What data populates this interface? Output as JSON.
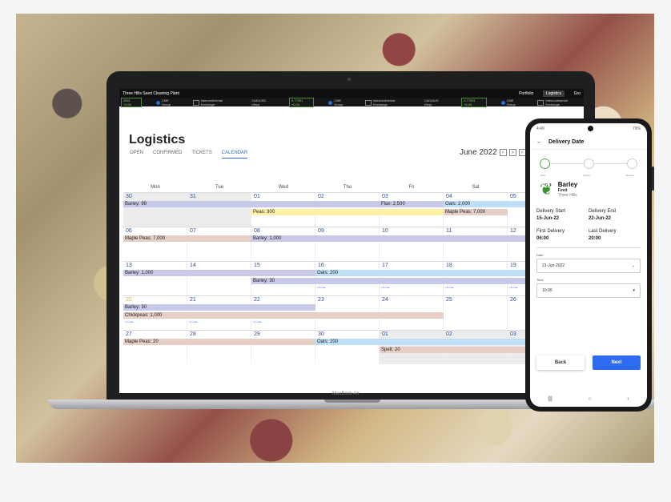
{
  "app": {
    "title": "Three Hills Seed Cleaning Plant",
    "nav": [
      "Portfolio",
      "Logistics",
      "Gro"
    ],
    "ticker": {
      "first": "0551 +0.00",
      "cme1": "CME Group",
      "ice1": "Intercontinental Exchange",
      "cadusd_label": "CAD/USD (Sep)",
      "cadusd_value": "0.77591 +0.00",
      "cme2": "CME Group",
      "ice2": "Intercontinental Exchange",
      "cadaud_label": "CAD/AUD (Sep)",
      "cadaud_value": "0.77591 +0.00",
      "cme3": "CME Group",
      "ice3": "Intercontinental Exchange"
    }
  },
  "page": {
    "title": "Logistics",
    "tabs": [
      "OPEN",
      "CONFIRMED",
      "TICKETS",
      "CALENDAR"
    ],
    "month": "June 2022",
    "prev": "<",
    "next": ">",
    "cut": "<"
  },
  "calendar": {
    "weekdays": [
      "Mon",
      "Tue",
      "Wed",
      "Thu",
      "Fri",
      "Sat",
      ""
    ],
    "weeks": [
      [
        "30",
        "31",
        "01",
        "02",
        "03",
        "04",
        "05"
      ],
      [
        "06",
        "07",
        "08",
        "09",
        "10",
        "11",
        "12"
      ],
      [
        "13",
        "14",
        "15",
        "16",
        "17",
        "18",
        "19"
      ],
      [
        "20",
        "21",
        "22",
        "23",
        "24",
        "25",
        "26"
      ],
      [
        "27",
        "28",
        "29",
        "30",
        "01",
        "02",
        "03"
      ]
    ],
    "events": {
      "w0_barley": "Barley: 99",
      "w0_flax": "Flax: 2,500",
      "w0_oats": "Oats: 2,000",
      "w0_peas": "Peas: 300",
      "w0_maple": "Maple Peas: 7,000",
      "w1_maple": "Maple Peas: 7,000",
      "w1_barley": "Barley: 1,000",
      "w2_barley": "Barley: 1,000",
      "w2_oats": "Oats: 200",
      "w2_barley30": "Barley: 30",
      "w3_barley": "Barley: 30",
      "w3_chick": "Chickpeas: 1,000",
      "w4_maple": "Maple Peas: 20",
      "w4_oats": "Oats: 200",
      "w4_spelt": "Spelt: 20"
    },
    "more": "+3 more",
    "more1": "+1 more",
    "more2": "+2 more"
  },
  "laptop": {
    "brand": "MacBook Air"
  },
  "phone": {
    "status_time": "4:49",
    "status_right": "79%",
    "header_title": "Delivery Date",
    "steps": [
      "Date",
      "Vehicle",
      "Review"
    ],
    "product": {
      "name": "Barley",
      "type": "Feed",
      "location": "Three Hills"
    },
    "delivery_start_label": "Delivery Start",
    "delivery_start": "15-Jun-22",
    "delivery_end_label": "Delivery End",
    "delivery_end": "22-Jun-22",
    "first_delivery_label": "First Delivery",
    "first_delivery": "06:00",
    "last_delivery_label": "Last Delivery",
    "last_delivery": "20:00",
    "date_label": "Date",
    "date_value": "21-Jun-2022",
    "time_label": "Time",
    "time_value": "10:00",
    "back_label": "Back",
    "next_label": "Next"
  },
  "colors": {
    "accent": "#2d6bf0",
    "purple_event": "#c8c9e8",
    "yellow_event": "#fff2a8",
    "blue_event": "#bee0f7",
    "salmon_event": "#e6cfc6"
  }
}
